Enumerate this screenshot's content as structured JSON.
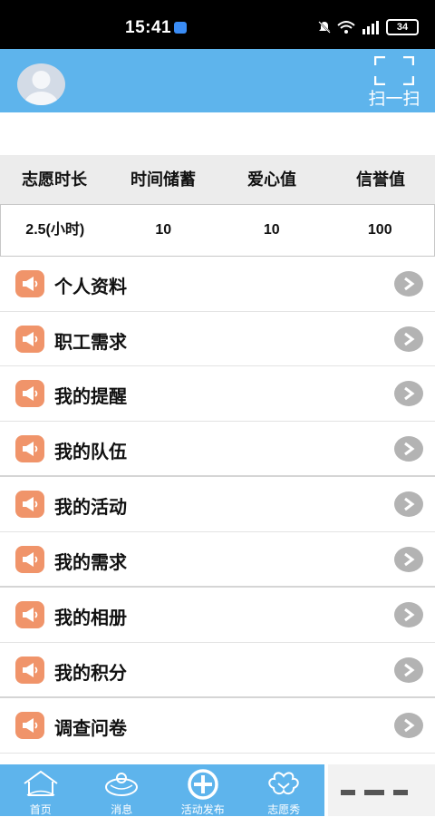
{
  "status_bar": {
    "time": "15:41",
    "battery": "34"
  },
  "header": {
    "scan_label": "扫一扫"
  },
  "stats": {
    "headers": [
      "志愿时长",
      "时间储蓄",
      "爱心值",
      "信誉值"
    ],
    "values": [
      "2.5(小时)",
      "10",
      "10",
      "100"
    ]
  },
  "menu": [
    {
      "label": "个人资料"
    },
    {
      "label": "职工需求"
    },
    {
      "label": "我的提醒"
    },
    {
      "label": "我的队伍"
    },
    {
      "label": "我的活动"
    },
    {
      "label": "我的需求"
    },
    {
      "label": "我的相册"
    },
    {
      "label": "我的积分"
    },
    {
      "label": "调查问卷"
    }
  ],
  "tabs": [
    {
      "label": "首页",
      "icon": "house-icon"
    },
    {
      "label": "消息",
      "icon": "message-icon"
    },
    {
      "label": "活动发布",
      "icon": "plus-circle-icon"
    },
    {
      "label": "志愿秀",
      "icon": "volunteer-icon"
    }
  ],
  "colors": {
    "primary": "#5eb4ec",
    "menu_icon": "#f0946a",
    "arrow": "#b3b3b3"
  }
}
